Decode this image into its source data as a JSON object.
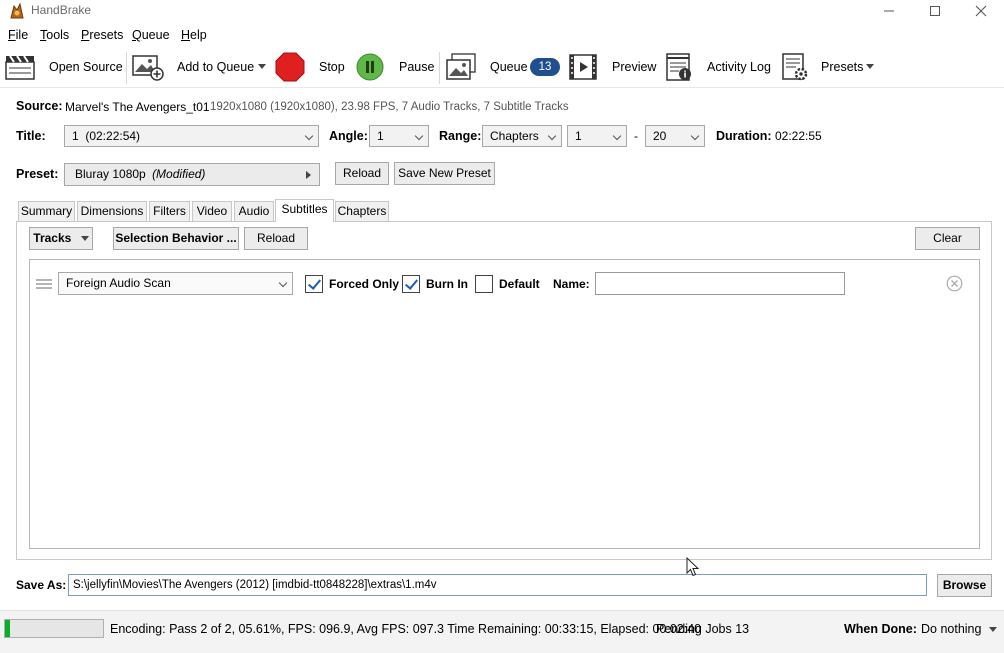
{
  "window": {
    "title": "HandBrake"
  },
  "menu": {
    "items": [
      {
        "label": "File"
      },
      {
        "label": "Tools"
      },
      {
        "label": "Presets"
      },
      {
        "label": "Queue"
      },
      {
        "label": "Help"
      }
    ]
  },
  "toolbar": {
    "open_source": "Open Source",
    "add_to_queue": "Add to Queue",
    "stop": "Stop",
    "pause": "Pause",
    "queue": "Queue",
    "queue_count": "13",
    "preview": "Preview",
    "activity_log": "Activity Log",
    "presets": "Presets"
  },
  "source": {
    "label": "Source:",
    "name": "Marvel's The Avengers_t01",
    "details": "1920x1080 (1920x1080), 23.98 FPS, 7 Audio Tracks, 7 Subtitle Tracks"
  },
  "title_row": {
    "title_label": "Title:",
    "title_value": "1  (02:22:54)",
    "angle_label": "Angle:",
    "angle_value": "1",
    "range_label": "Range:",
    "range_type": "Chapters",
    "range_start": "1",
    "range_sep": "-",
    "range_end": "20",
    "duration_label": "Duration:",
    "duration_value": "02:22:55"
  },
  "preset": {
    "label": "Preset:",
    "name": "Bluray 1080p",
    "modified": "(Modified)",
    "reload": "Reload",
    "save_new": "Save New Preset"
  },
  "tabs": [
    {
      "label": "Summary"
    },
    {
      "label": "Dimensions"
    },
    {
      "label": "Filters"
    },
    {
      "label": "Video"
    },
    {
      "label": "Audio"
    },
    {
      "label": "Subtitles",
      "active": true
    },
    {
      "label": "Chapters"
    }
  ],
  "subtitles": {
    "tracks_button": "Tracks",
    "selection_behavior": "Selection Behavior ...",
    "reload": "Reload",
    "clear": "Clear",
    "track": {
      "source": "Foreign Audio Scan",
      "forced_only_label": "Forced Only",
      "forced_only": true,
      "burn_in_label": "Burn In",
      "burn_in": true,
      "default_label": "Default",
      "default": false,
      "name_label": "Name:",
      "name_value": ""
    }
  },
  "save_as": {
    "label": "Save As:",
    "path": "S:\\jellyfin\\Movies\\The Avengers (2012) [imdbid-tt0848228]\\extras\\1.m4v",
    "browse": "Browse"
  },
  "status": {
    "progress_percent": 5.61,
    "encoding_text": "Encoding: Pass 2 of 2,  05.61%, FPS: 096.9,  Avg FPS: 097.3 Time Remaining: 00:33:15,  Elapsed: 00:02:40",
    "pending_jobs": "Pending Jobs 13",
    "when_done_label": "When Done:",
    "when_done_value": "Do nothing"
  },
  "colors": {
    "stop": "#e02020",
    "pause": "#5fb848",
    "badge": "#1f4f8f",
    "progress": "#06b025",
    "check": "#1a5fb4"
  }
}
